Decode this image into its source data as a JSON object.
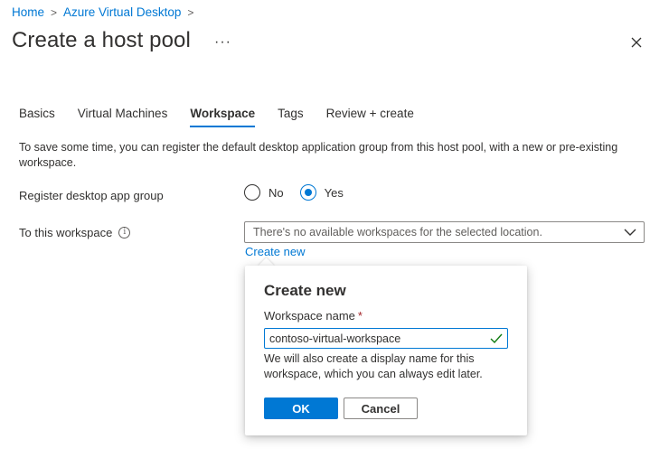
{
  "breadcrumb": {
    "items": [
      "Home",
      "Azure Virtual Desktop"
    ],
    "separator": ">"
  },
  "page": {
    "title": "Create a host pool",
    "more_label": "···"
  },
  "tabs": [
    {
      "label": "Basics",
      "active": false
    },
    {
      "label": "Virtual Machines",
      "active": false
    },
    {
      "label": "Workspace",
      "active": true
    },
    {
      "label": "Tags",
      "active": false
    },
    {
      "label": "Review + create",
      "active": false
    }
  ],
  "description": "To save some time, you can register the default desktop application group from this host pool, with a new or pre-existing workspace.",
  "register": {
    "label": "Register desktop app group",
    "options": [
      {
        "label": "No",
        "checked": false
      },
      {
        "label": "Yes",
        "checked": true
      }
    ]
  },
  "workspace": {
    "label": "To this workspace",
    "info_icon": "info-icon",
    "dropdown_text": "There's no available workspaces for the selected location.",
    "create_new_label": "Create new"
  },
  "callout": {
    "title": "Create new",
    "field_label": "Workspace name",
    "required_mark": "*",
    "input_value": "contoso-virtual-workspace",
    "help_text": "We will also create a display name for this workspace, which you can always edit later.",
    "ok_label": "OK",
    "cancel_label": "Cancel"
  },
  "colors": {
    "accent": "#0078d4",
    "valid": "#107c10",
    "required": "#a4262c"
  }
}
